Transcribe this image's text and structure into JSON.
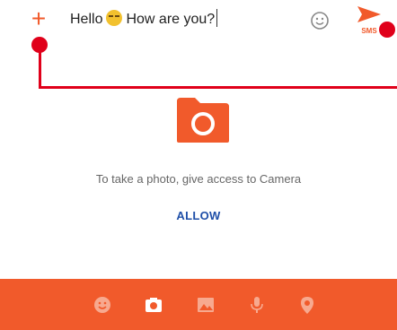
{
  "compose": {
    "text_before_emoji": "Hello",
    "emoji_icon": "grinning-face-emoji",
    "text_after_emoji": "How are you?",
    "send_label": "SMS"
  },
  "camera_prompt": {
    "message": "To take a photo, give access to Camera",
    "allow_label": "ALLOW"
  },
  "toolbar": {
    "icons": [
      "sticker-icon",
      "camera-icon",
      "gallery-icon",
      "microphone-icon",
      "location-icon"
    ]
  },
  "colors": {
    "accent": "#f15a2b",
    "link": "#1f4fa8",
    "annotation": "#e0001a"
  }
}
